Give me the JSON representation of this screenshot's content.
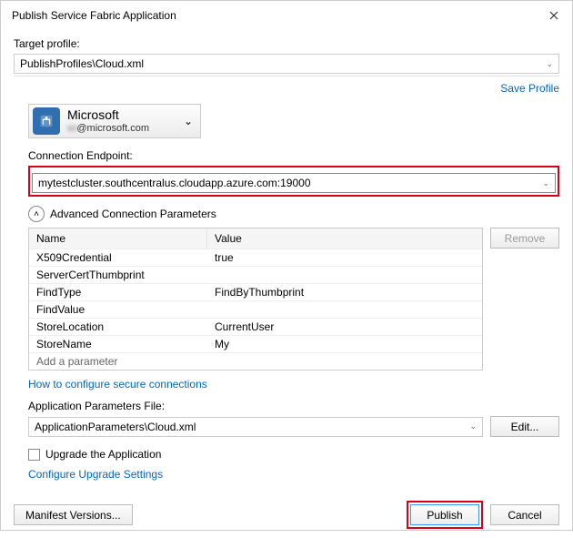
{
  "window": {
    "title": "Publish Service Fabric Application"
  },
  "targetProfile": {
    "label": "Target profile:",
    "value": "PublishProfiles\\Cloud.xml",
    "saveLink": "Save Profile"
  },
  "account": {
    "name": "Microsoft",
    "emailPrefixMasked": "         wi",
    "emailDomain": "@microsoft.com"
  },
  "connection": {
    "label": "Connection Endpoint:",
    "value": "mytestcluster.southcentralus.cloudapp.azure.com:19000"
  },
  "advanced": {
    "title": "Advanced Connection Parameters",
    "headers": {
      "name": "Name",
      "value": "Value"
    },
    "rows": [
      {
        "name": "X509Credential",
        "value": "true"
      },
      {
        "name": "ServerCertThumbprint",
        "value": ""
      },
      {
        "name": "FindType",
        "value": "FindByThumbprint"
      },
      {
        "name": "FindValue",
        "value": ""
      },
      {
        "name": "StoreLocation",
        "value": "CurrentUser"
      },
      {
        "name": "StoreName",
        "value": "My"
      },
      {
        "name": "Add a parameter",
        "value": ""
      }
    ],
    "removeBtn": "Remove",
    "secureLink": "How to configure secure connections"
  },
  "appParams": {
    "label": "Application Parameters File:",
    "value": "ApplicationParameters\\Cloud.xml",
    "editBtn": "Edit..."
  },
  "upgrade": {
    "checkboxLabel": "Upgrade the Application",
    "configureLink": "Configure Upgrade Settings"
  },
  "footer": {
    "manifest": "Manifest Versions...",
    "publish": "Publish",
    "cancel": "Cancel"
  }
}
